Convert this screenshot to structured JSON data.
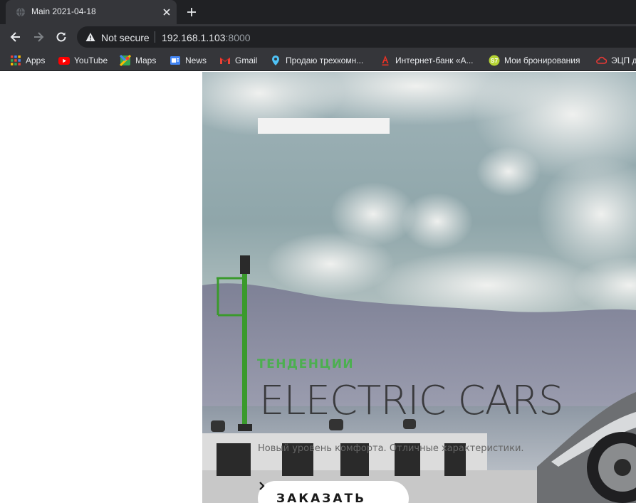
{
  "browser": {
    "tab_title": "Main 2021-04-18",
    "security_label": "Not secure",
    "url_host": "192.168.1.103",
    "url_port": ":8000"
  },
  "bookmarks": [
    {
      "label": "Apps",
      "icon": "apps-grid-icon"
    },
    {
      "label": "YouTube",
      "icon": "youtube-icon"
    },
    {
      "label": "Maps",
      "icon": "maps-icon"
    },
    {
      "label": "News",
      "icon": "news-icon"
    },
    {
      "label": "Gmail",
      "icon": "gmail-icon"
    },
    {
      "label": "Продаю трехкомн...",
      "icon": "map-pin-icon"
    },
    {
      "label": "Интернет-банк «А...",
      "icon": "alfa-bank-icon"
    },
    {
      "label": "Мои бронирования",
      "icon": "s7-icon"
    },
    {
      "label": "ЭЦП д",
      "icon": "cloud-icon"
    }
  ],
  "hero": {
    "eyebrow": "ТЕНДЕНЦИИ",
    "headline": "ELECTRIC CARS",
    "subtitle": "Новый уровень комфорта. Отличные характеристики.",
    "cta_label": "ЗАКАЗАТЬ"
  },
  "colors": {
    "chrome_dark": "#202124",
    "chrome_tab": "#35363a",
    "accent_green": "#4caf50"
  }
}
